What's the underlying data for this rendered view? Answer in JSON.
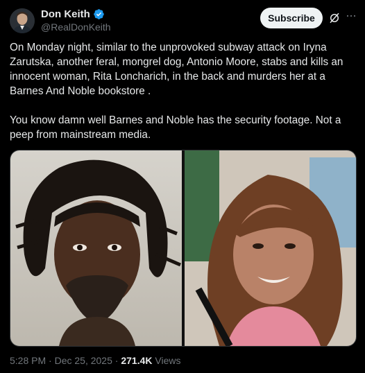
{
  "post": {
    "author_name": "Don Keith",
    "handle": "@RealDonKeith",
    "subscribe_label": "Subscribe",
    "text": "On Monday night, similar to the unprovoked subway attack on Iryna Zarutska, another feral, mongrel dog, Antonio Moore, stabs and kills an innocent woman, Rita Loncharich, in the back and murders her at a Barnes And Noble bookstore .\n\nYou know damn well Barnes and Noble has the security footage. Not a peep from mainstream media.",
    "time": "5:28 PM",
    "date": "Dec 25, 2025",
    "views_count": "271.4K",
    "views_label": "Views"
  },
  "icons": {
    "verified": "verified-badge-icon",
    "grok": "grok-icon",
    "more": "more-options-icon"
  },
  "colors": {
    "background": "#000000",
    "text": "#e7e9ea",
    "secondary_text": "#71767b",
    "verified_blue": "#1d9bf0",
    "subscribe_bg": "#eff3f4"
  }
}
